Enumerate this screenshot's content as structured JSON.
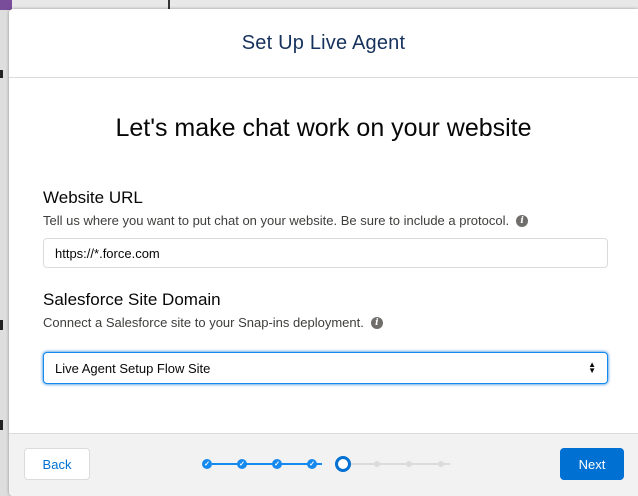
{
  "modal": {
    "title": "Set Up Live Agent",
    "headline": "Let's make chat work on your website"
  },
  "website_url": {
    "label": "Website URL",
    "help": "Tell us where you want to put chat on your website. Be sure to include a protocol.",
    "value": "https://*.force.com"
  },
  "site_domain": {
    "label": "Salesforce Site Domain",
    "help": "Connect a Salesforce site to your Snap-ins deployment.",
    "selected": "Live Agent Setup Flow Site"
  },
  "footer": {
    "back_label": "Back",
    "next_label": "Next"
  },
  "progress": {
    "total_steps": 8,
    "current_step": 5
  },
  "colors": {
    "brand": "#0070d2",
    "progress_done": "#1589ee",
    "progress_todo": "#dddbda"
  },
  "icons": {
    "info": "info-icon",
    "check": "check-icon",
    "select_arrows": "select-arrows-icon"
  }
}
